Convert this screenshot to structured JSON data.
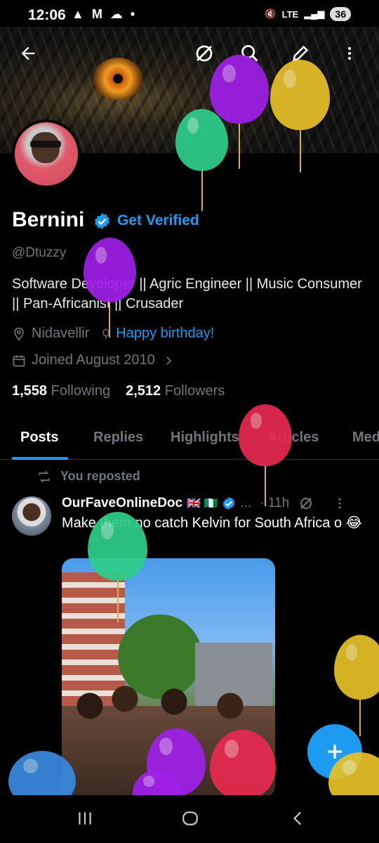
{
  "status_bar": {
    "time": "12:06",
    "notifications": "▲ M ☁ •",
    "network": "LTE",
    "battery": "36"
  },
  "profile": {
    "name": "Bernini",
    "get_verified": "Get Verified",
    "handle": "@Dtuzzy",
    "bio": "Software Developer || Agric Engineer || Music Consumer || Pan-Africanist || Crusader",
    "location": "Nidavellir",
    "birthday": "Happy birthday!",
    "joined": "Joined August 2010",
    "following_count": "1,558",
    "following_label": "Following",
    "followers_count": "2,512",
    "followers_label": "Followers"
  },
  "tabs": [
    "Posts",
    "Replies",
    "Highlights",
    "Articles",
    "Med"
  ],
  "post": {
    "repost_label": "You reposted",
    "author": "OurFaveOnlineDoc",
    "flags": "🇬🇧 🇳🇬",
    "ellipsis": "...",
    "time": "· 11h",
    "text": "Make them no catch Kelvin for South Africa o 😂"
  },
  "icons": [
    "back-arrow-icon",
    "grok-icon",
    "search-icon",
    "edit-icon",
    "more-vert-icon",
    "verified-badge-icon",
    "location-icon",
    "balloon-icon",
    "calendar-icon",
    "chevron-right-icon",
    "repost-icon",
    "plus-icon"
  ],
  "colors": {
    "accent": "#1d9bf0",
    "background": "#000000",
    "muted": "#71767b"
  }
}
